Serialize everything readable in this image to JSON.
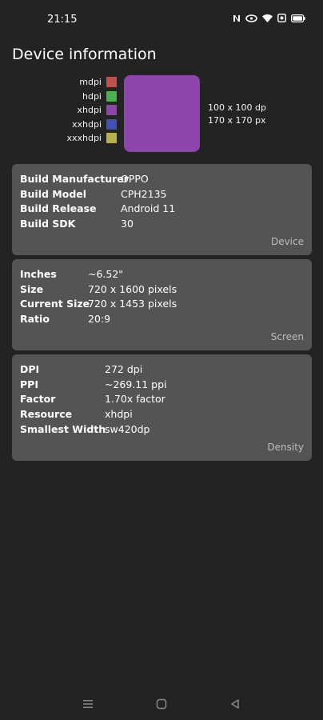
{
  "status_bar": {
    "time": "21:15",
    "icons": [
      "nfc-icon",
      "data-saver-icon",
      "wifi-icon",
      "screen-record-icon",
      "battery-icon"
    ]
  },
  "page_title": "Device information",
  "density_legend": [
    {
      "label": "mdpi",
      "color": "#c0504d"
    },
    {
      "label": "hdpi",
      "color": "#4caf50"
    },
    {
      "label": "xhdpi",
      "color": "#8e44ad"
    },
    {
      "label": "xxhdpi",
      "color": "#3f51b5"
    },
    {
      "label": "xxxhdpi",
      "color": "#b8b04a"
    }
  ],
  "preview": {
    "color": "#8e44ad",
    "dp_size": "100 x 100 dp",
    "px_size": "170 x 170 px"
  },
  "device_card": {
    "rows": [
      {
        "label": "Build Manufacturer",
        "value": "OPPO"
      },
      {
        "label": "Build Model",
        "value": "CPH2135"
      },
      {
        "label": "Build Release",
        "value": "Android 11"
      },
      {
        "label": "Build SDK",
        "value": "30"
      }
    ],
    "footer": "Device"
  },
  "screen_card": {
    "rows": [
      {
        "label": "Inches",
        "value": "~6.52\""
      },
      {
        "label": "Size",
        "value": "720 x 1600 pixels"
      },
      {
        "label": "Current Size",
        "value": "720 x 1453 pixels"
      },
      {
        "label": "Ratio",
        "value": "20:9"
      }
    ],
    "footer": "Screen"
  },
  "density_card": {
    "rows": [
      {
        "label": "DPI",
        "value": "272 dpi"
      },
      {
        "label": "PPI",
        "value": "~269.11 ppi"
      },
      {
        "label": "Factor",
        "value": "1.70x factor"
      },
      {
        "label": "Resource",
        "value": "xhdpi"
      },
      {
        "label": "Smallest Width",
        "value": "sw420dp"
      }
    ],
    "footer": "Density"
  },
  "nav_bar": {
    "buttons": [
      "menu-icon",
      "home-icon",
      "back-icon"
    ]
  }
}
